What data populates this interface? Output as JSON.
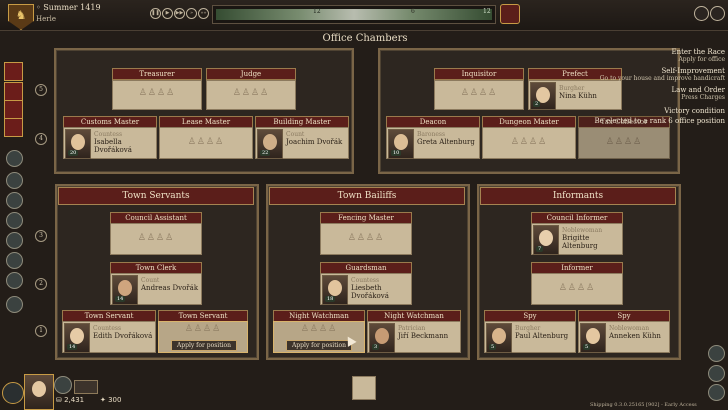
{
  "topbar": {
    "season": "Summer 1419",
    "town": "Herle",
    "crest_icon": "lion-crest-icon",
    "timeline_ticks": [
      "12",
      "6",
      "12"
    ]
  },
  "title": "Office Chambers",
  "row_numbers": [
    "5",
    "4",
    "3",
    "2",
    "1"
  ],
  "top_left": {
    "row5": [
      {
        "title": "Treasurer"
      },
      {
        "title": "Judge"
      }
    ],
    "row4": [
      {
        "title": "Customs Master",
        "rank": "Countess",
        "name": "Isabella Dvořáková",
        "level": "20"
      },
      {
        "title": "Lease Master"
      },
      {
        "title": "Building Master",
        "rank": "Count",
        "name": "Joachim Dvořák",
        "level": "22"
      }
    ]
  },
  "top_right": {
    "row5": [
      {
        "title": "Inquisitor"
      },
      {
        "title": "Prefect",
        "rank": "Burgher",
        "name": "Nina Kühn",
        "level": "2"
      }
    ],
    "row4": [
      {
        "title": "Deacon",
        "rank": "Baroness",
        "name": "Greta Altenburg",
        "level": "10"
      },
      {
        "title": "Dungeon Master"
      },
      {
        "title": "Tax Collector"
      }
    ]
  },
  "sections": {
    "servants": {
      "title": "Town Servants",
      "council_assistant": {
        "title": "Council Assistant"
      },
      "town_clerk": {
        "title": "Town Clerk",
        "rank": "Count",
        "name": "Andreas Dvořák",
        "level": "14"
      },
      "servant1": {
        "title": "Town Servant",
        "rank": "Countess",
        "name": "Edith Dvořáková",
        "level": "14"
      },
      "servant2": {
        "title": "Town Servant",
        "apply": "Apply for position"
      }
    },
    "bailiffs": {
      "title": "Town Bailiffs",
      "fencing_master": {
        "title": "Fencing Master"
      },
      "guardsman": {
        "title": "Guardsman",
        "rank": "Countess",
        "name": "Liesbeth Dvořáková",
        "level": "18"
      },
      "night1": {
        "title": "Night Watchman",
        "apply": "Apply for position"
      },
      "night2": {
        "title": "Night Watchman",
        "rank": "Patrician",
        "name": "Jiří Beckmann",
        "level": "3"
      }
    },
    "informants": {
      "title": "Informants",
      "council_informer": {
        "title": "Council Informer",
        "rank": "Noblewoman",
        "name": "Brigitte Altenburg",
        "level": "7"
      },
      "informer": {
        "title": "Informer"
      },
      "spy1": {
        "title": "Spy",
        "rank": "Burgher",
        "name": "Paul Altenburg",
        "level": "5"
      },
      "spy2": {
        "title": "Spy",
        "rank": "Noblewoman",
        "name": "Anneken Kühn",
        "level": "5"
      }
    }
  },
  "objectives": [
    {
      "title": "Enter the Race",
      "sub": "Apply for office"
    },
    {
      "title": "Self-Improvement",
      "sub": "Go to your house and improve handicraft"
    },
    {
      "title": "Law and Order",
      "sub": "Press Charges"
    },
    {
      "title": "Victory condition",
      "sub": ""
    },
    {
      "title": "Be elected to a rank 6 office position",
      "sub": ""
    }
  ],
  "player": {
    "money": "2,431",
    "stat": "300"
  },
  "footer": "Shipping 0.3.0.25165 [902] - Early Access"
}
